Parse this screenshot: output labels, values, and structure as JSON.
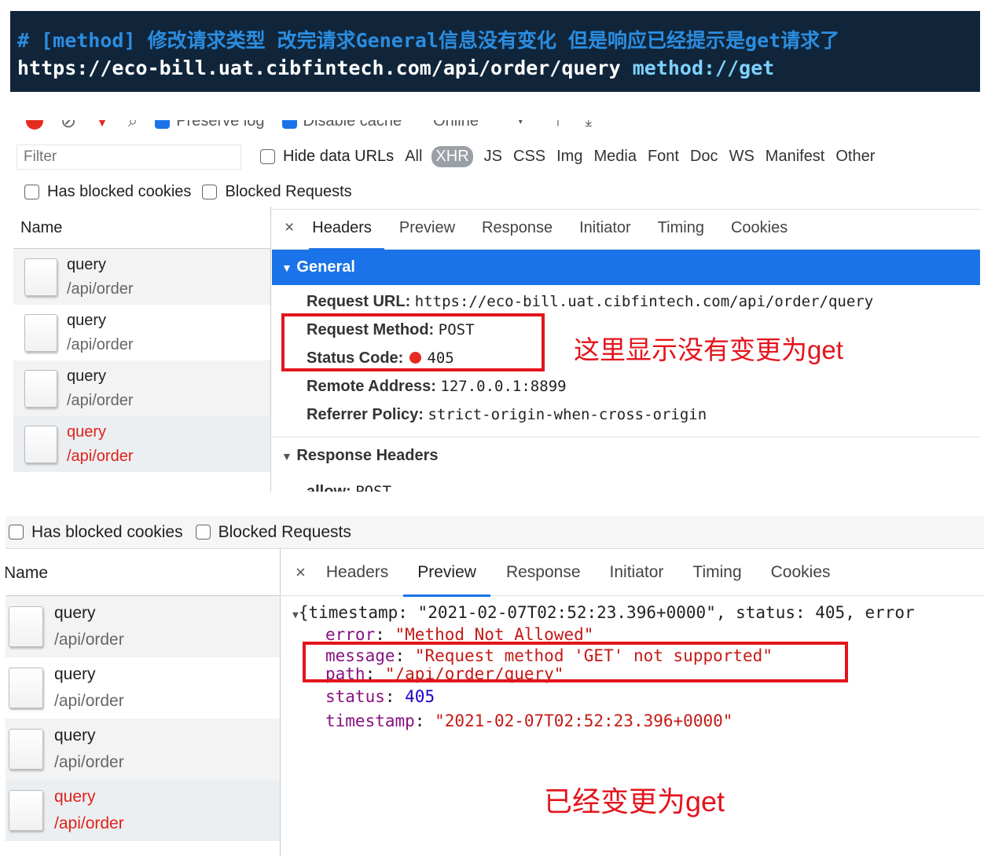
{
  "banner": {
    "comment": "# [method] 修改请求类型 改完请求General信息没有变化 但是响应已经提示是get请求了",
    "url": "https://eco-bill.uat.cibfintech.com/api/order/query",
    "method_note": "method://get"
  },
  "panel1": {
    "toolbar": {
      "preserve_log": "Preserve log",
      "disable_cache": "Disable cache",
      "throttle": "Online"
    },
    "filter": {
      "placeholder": "Filter",
      "hide_data_urls": "Hide data URLs",
      "types": [
        "All",
        "XHR",
        "JS",
        "CSS",
        "Img",
        "Media",
        "Font",
        "Doc",
        "WS",
        "Manifest",
        "Other"
      ]
    },
    "has_blocked_cookies": "Has blocked cookies",
    "blocked_requests": "Blocked Requests",
    "name_header": "Name",
    "requests": [
      {
        "name": "query",
        "path": "/api/order"
      },
      {
        "name": "query",
        "path": "/api/order"
      },
      {
        "name": "query",
        "path": "/api/order"
      },
      {
        "name": "query",
        "path": "/api/order"
      }
    ],
    "tabs": {
      "close": "×",
      "items": [
        "Headers",
        "Preview",
        "Response",
        "Initiator",
        "Timing",
        "Cookies"
      ]
    },
    "general": {
      "title": "General",
      "request_url_label": "Request URL:",
      "request_url": "https://eco-bill.uat.cibfintech.com/api/order/query",
      "request_method_label": "Request Method:",
      "request_method": "POST",
      "status_code_label": "Status Code:",
      "status_code": "405",
      "remote_address_label": "Remote Address:",
      "remote_address": "127.0.0.1:8899",
      "referrer_policy_label": "Referrer Policy:",
      "referrer_policy": "strict-origin-when-cross-origin"
    },
    "response_headers": {
      "title": "Response Headers",
      "allow_label": "allow:",
      "allow": "POST"
    },
    "annotation": "这里显示没有变更为get"
  },
  "panel2": {
    "has_blocked_cookies": "Has blocked cookies",
    "blocked_requests": "Blocked Requests",
    "name_header": "Name",
    "requests": [
      {
        "name": "query",
        "path": "/api/order"
      },
      {
        "name": "query",
        "path": "/api/order"
      },
      {
        "name": "query",
        "path": "/api/order"
      },
      {
        "name": "query",
        "path": "/api/order"
      }
    ],
    "tabs": {
      "close": "×",
      "items": [
        "Headers",
        "Preview",
        "Response",
        "Initiator",
        "Timing",
        "Cookies"
      ]
    },
    "preview": {
      "summary": "{timestamp: \"2021-02-07T02:52:23.396+0000\", status: 405, error",
      "error_key": "error",
      "error_val": "\"Method Not Allowed\"",
      "message_key": "message",
      "message_val": "\"Request method 'GET' not supported\"",
      "path_key": "path",
      "path_val": "\"/api/order/query\"",
      "status_key": "status",
      "status_val": "405",
      "timestamp_key": "timestamp",
      "timestamp_val": "\"2021-02-07T02:52:23.396+0000\""
    },
    "annotation": "已经变更为get"
  },
  "colors": {
    "banner_bg": "#10253a",
    "accent_blue": "#1a73e8",
    "annotation_red": "#e4141c",
    "error_red": "#e0201a"
  }
}
